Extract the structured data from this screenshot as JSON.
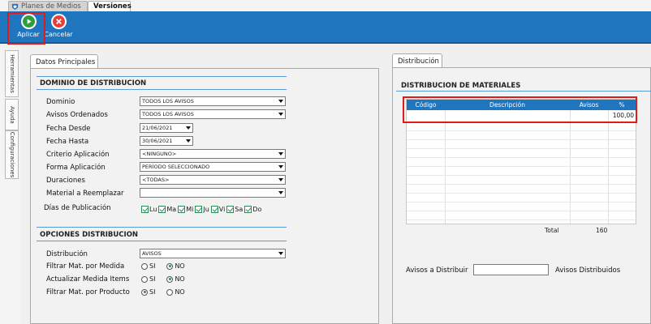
{
  "doc_tabs": [
    {
      "label": "Planes de Medios",
      "active": false
    },
    {
      "label": "Versiones",
      "active": true
    }
  ],
  "toolbar": {
    "apply_label": "Aplicar",
    "cancel_label": "Cancelar"
  },
  "side_tabs": [
    "Herramientas",
    "Ayuda",
    "Configuraciones"
  ],
  "left_panel": {
    "tab": "Datos Principales",
    "dominio": {
      "title": "DOMINIO DE DISTRIBUCION",
      "fields": [
        {
          "label": "Dominio",
          "value": "TODOS LOS AVISOS"
        },
        {
          "label": "Avisos Ordenados",
          "value": "TODOS LOS AVISOS"
        },
        {
          "label": "Fecha Desde",
          "value": "21/06/2021"
        },
        {
          "label": "Fecha Hasta",
          "value": "30/06/2021"
        },
        {
          "label": "Criterio Aplicación",
          "value": "<NINGUNO>"
        },
        {
          "label": "Forma Aplicación",
          "value": "PERÍODO SELECCIONADO"
        },
        {
          "label": "Duraciones",
          "value": "<TODAS>"
        },
        {
          "label": "Material a Reemplazar",
          "value": ""
        }
      ],
      "dias_label": "Días de Publicación",
      "dias": [
        "Lu",
        "Ma",
        "Mi",
        "Ju",
        "Vi",
        "Sa",
        "Do"
      ]
    },
    "opciones": {
      "title": "OPCIONES DISTRIBUCION",
      "distribucion_label": "Distribución",
      "distribucion_value": "AVISOS",
      "radios": [
        {
          "label": "Filtrar Mat. por Medida",
          "selected": "NO"
        },
        {
          "label": "Actualizar Medida Items",
          "selected": "NO"
        },
        {
          "label": "Filtrar Mat. por Producto",
          "selected": "SI"
        }
      ],
      "si": "SI",
      "no": "NO"
    }
  },
  "right_panel": {
    "tab": "Distribución",
    "title": "DISTRIBUCION DE MATERIALES",
    "columns": [
      "Código",
      "Descripción",
      "Avisos",
      "%"
    ],
    "first_row_percent": "100,00",
    "total_label": "Total",
    "total_value": "160",
    "avisos_a_distribuir_label": "Avisos a Distribuir",
    "avisos_distribuidos_label": "Avisos Distribuidos"
  },
  "colors": {
    "toolbar": "#1f75be",
    "highlight": "#e01b1b",
    "apply": "#2e9e3c",
    "cancel": "#e63d3d"
  }
}
